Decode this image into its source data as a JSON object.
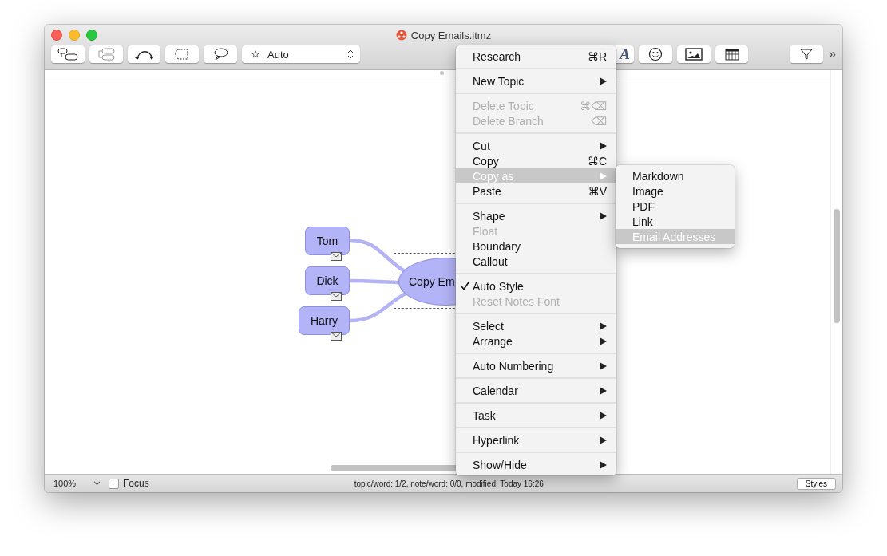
{
  "window": {
    "title": "Copy Emails.itmz"
  },
  "toolbar": {
    "style_dropdown": {
      "value": "Auto"
    },
    "font_button": {
      "label": "A"
    },
    "overflow": "»"
  },
  "canvas": {
    "central_topic": {
      "text": "Copy Em",
      "selected": true
    },
    "topics": [
      {
        "text": "Tom",
        "has_email": true
      },
      {
        "text": "Dick",
        "has_email": true
      },
      {
        "text": "Harry",
        "has_email": true
      }
    ]
  },
  "context_menu": {
    "groups": [
      [
        {
          "label": "Research",
          "shortcut": "⌘R",
          "submenu": false,
          "disabled": false,
          "checked": false,
          "selected": false
        }
      ],
      [
        {
          "label": "New Topic",
          "submenu": true,
          "disabled": false,
          "checked": false,
          "selected": false
        }
      ],
      [
        {
          "label": "Delete Topic",
          "shortcut": "⌘⌫",
          "submenu": false,
          "disabled": true,
          "checked": false,
          "selected": false
        },
        {
          "label": "Delete Branch",
          "shortcut": "⌫",
          "submenu": false,
          "disabled": true,
          "checked": false,
          "selected": false
        }
      ],
      [
        {
          "label": "Cut",
          "submenu": true,
          "disabled": false,
          "checked": false,
          "selected": false
        },
        {
          "label": "Copy",
          "shortcut": "⌘C",
          "submenu": false,
          "disabled": false,
          "checked": false,
          "selected": false
        },
        {
          "label": "Copy as",
          "submenu": true,
          "disabled": false,
          "checked": false,
          "selected": true
        },
        {
          "label": "Paste",
          "shortcut": "⌘V",
          "submenu": false,
          "disabled": false,
          "checked": false,
          "selected": false
        }
      ],
      [
        {
          "label": "Shape",
          "submenu": true,
          "disabled": false,
          "checked": false,
          "selected": false
        },
        {
          "label": "Float",
          "submenu": false,
          "disabled": true,
          "checked": false,
          "selected": false
        },
        {
          "label": "Boundary",
          "submenu": false,
          "disabled": false,
          "checked": false,
          "selected": false
        },
        {
          "label": "Callout",
          "submenu": false,
          "disabled": false,
          "checked": false,
          "selected": false
        }
      ],
      [
        {
          "label": "Auto Style",
          "submenu": false,
          "disabled": false,
          "checked": true,
          "selected": false
        },
        {
          "label": "Reset Notes Font",
          "submenu": false,
          "disabled": true,
          "checked": false,
          "selected": false
        }
      ],
      [
        {
          "label": "Select",
          "submenu": true,
          "disabled": false,
          "checked": false,
          "selected": false
        },
        {
          "label": "Arrange",
          "submenu": true,
          "disabled": false,
          "checked": false,
          "selected": false
        }
      ],
      [
        {
          "label": "Auto Numbering",
          "submenu": true,
          "disabled": false,
          "checked": false,
          "selected": false
        }
      ],
      [
        {
          "label": "Calendar",
          "submenu": true,
          "disabled": false,
          "checked": false,
          "selected": false
        }
      ],
      [
        {
          "label": "Task",
          "submenu": true,
          "disabled": false,
          "checked": false,
          "selected": false
        }
      ],
      [
        {
          "label": "Hyperlink",
          "submenu": true,
          "disabled": false,
          "checked": false,
          "selected": false
        }
      ],
      [
        {
          "label": "Show/Hide",
          "submenu": true,
          "disabled": false,
          "checked": false,
          "selected": false
        }
      ]
    ]
  },
  "submenu": {
    "items": [
      {
        "label": "Markdown",
        "selected": false
      },
      {
        "label": "Image",
        "selected": false
      },
      {
        "label": "PDF",
        "selected": false
      },
      {
        "label": "Link",
        "selected": false
      },
      {
        "label": "Email Addresses",
        "selected": true
      }
    ]
  },
  "status_bar": {
    "zoom": "100%",
    "focus": {
      "label": "Focus",
      "checked": false
    },
    "info": "topic/word: 1/2, note/word: 0/0, modified: Today 16:26",
    "styles_button": "Styles"
  }
}
